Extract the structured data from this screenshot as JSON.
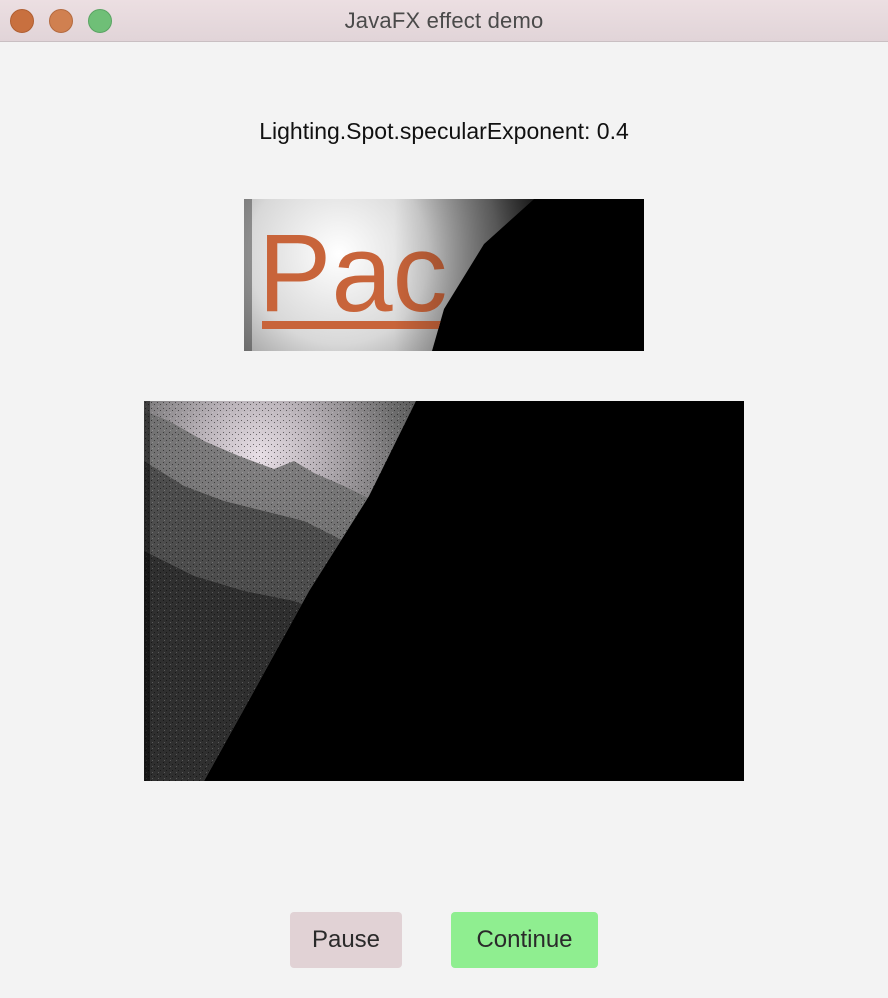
{
  "window": {
    "title": "JavaFX effect demo"
  },
  "effect": {
    "label": "Lighting.Spot.specularExponent: 0.4"
  },
  "logo_image": {
    "text": "Pac",
    "text_color": "#c8643a"
  },
  "buttons": {
    "pause_label": "Pause",
    "continue_label": "Continue"
  },
  "colors": {
    "pause_bg": "#e1d2d5",
    "continue_bg": "#8fee90",
    "window_bg": "#f3f3f3"
  }
}
